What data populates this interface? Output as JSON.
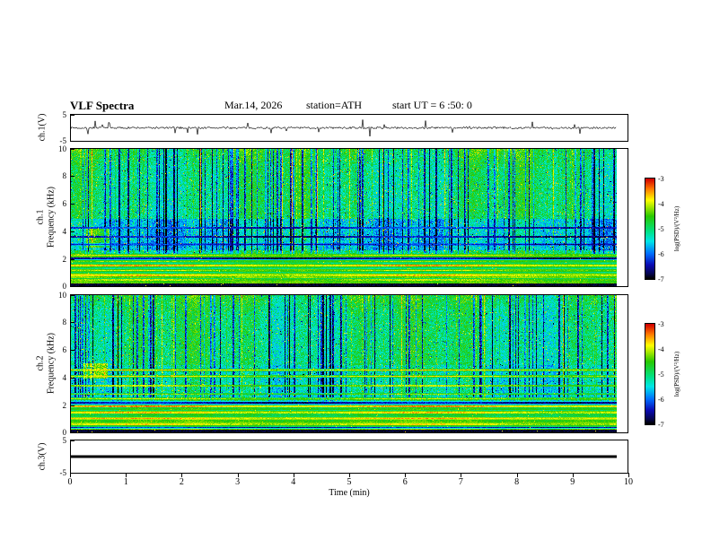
{
  "header": {
    "title": "VLF Spectra",
    "date": "Mar.14, 2026",
    "station": "station=ATH",
    "start_ut": "start UT =  6 :50: 0"
  },
  "x_axis": {
    "label": "Time (min)",
    "ticks": [
      0,
      1,
      2,
      3,
      4,
      5,
      6,
      7,
      8,
      9,
      10
    ],
    "range": [
      0,
      10
    ]
  },
  "colorbar": {
    "label": "log(PSD)/(V²/Hz)",
    "ticks": [
      -3,
      -4,
      -5,
      -6,
      -7
    ],
    "range": [
      -3,
      -7
    ],
    "gradient_top_to_bottom": [
      "#d20000",
      "#ff7800",
      "#ffff00",
      "#28c800",
      "#00e182",
      "#00e6e6",
      "#006eff",
      "#0a0ab4",
      "#050550",
      "#000000"
    ]
  },
  "chart_data": [
    {
      "type": "line",
      "panel": "ch1-waveform",
      "ylabel": "ch.1(V)",
      "ylim": [
        -5,
        5
      ],
      "y_ticks": [
        5,
        -5
      ],
      "x_range_min": [
        0,
        9.8
      ],
      "description": "Broadband noise trace oscillating around 0 V with frequent impulsive sferic spikes up to about ±4 V",
      "seed": 7,
      "noise_v": 0.4,
      "spike_prob": 0.05,
      "spike_v": 3.0
    },
    {
      "type": "heatmap",
      "panel": "ch1-spectrogram",
      "ylabel_ch": "ch.1",
      "ylabel_axis": "Frequency (kHz)",
      "ylim": [
        0,
        10
      ],
      "y_ticks": [
        0,
        2,
        4,
        6,
        8,
        10
      ],
      "x_range_min": [
        0,
        9.8
      ],
      "value_range": [
        -7,
        -3
      ],
      "description": "VLF power spectral density: green/cyan background near -5, dense vertical dark-blue dropout stripes above 2.3 kHz, suppressed blue band 2.6-4.9 kHz, strong red/orange horizontal lines below 2.3 kHz, black band at 0 kHz, bright patch near 0.3-0.7 min at 3-4 kHz",
      "seed": 21,
      "stripe_density": 0.17,
      "bands": [
        {
          "f0": 2.6,
          "f1": 4.9,
          "dv": -0.55
        },
        {
          "f0": 0.18,
          "f1": 2.3,
          "dv": 0.15
        },
        {
          "f0": 0.18,
          "f1": 1.0,
          "dv": 0.3
        }
      ],
      "lines": [
        {
          "f": 0.45,
          "w": 0.05,
          "level": -4.3
        },
        {
          "f": 0.8,
          "w": 0.05,
          "level": -3.9
        },
        {
          "f": 1.15,
          "w": 0.04,
          "level": -4.2
        },
        {
          "f": 1.5,
          "w": 0.05,
          "level": -3.8
        },
        {
          "f": 1.8,
          "w": 0.04,
          "level": -4.4
        },
        {
          "f": 2.0,
          "w": 0.06,
          "level": -6.6
        },
        {
          "f": 2.25,
          "w": 0.04,
          "level": -4.1
        },
        {
          "f": 3.05,
          "w": 0.05,
          "level": -6.4
        },
        {
          "f": 3.6,
          "w": 0.05,
          "level": -6.5
        },
        {
          "f": 4.25,
          "w": 0.05,
          "level": -6.3
        }
      ],
      "blobs": [
        {
          "t0": 0.25,
          "t1": 0.7,
          "f0": 2.8,
          "f1": 4.3,
          "dv": 1.2
        }
      ]
    },
    {
      "type": "heatmap",
      "panel": "ch2-spectrogram",
      "ylabel_ch": "ch.2",
      "ylabel_axis": "Frequency (kHz)",
      "ylim": [
        0,
        10
      ],
      "y_ticks": [
        0,
        2,
        4,
        6,
        8,
        10
      ],
      "x_range_min": [
        0,
        9.8
      ],
      "value_range": [
        -7,
        -3
      ],
      "description": "Similar to ch.1 but less suppression at mid band; red horizontal lines near 4.1 and 4.55 kHz, dense warm horizontal streaks below 2.3 kHz, dark line near 2.15 kHz, black band at 0 kHz, bright yellow patch near 0.3 min at 4-5 kHz",
      "seed": 55,
      "stripe_density": 0.13,
      "bands": [
        {
          "f0": 2.5,
          "f1": 4.9,
          "dv": -0.25
        },
        {
          "f0": 0.18,
          "f1": 2.3,
          "dv": 0.2
        },
        {
          "f0": 0.18,
          "f1": 1.0,
          "dv": 0.3
        }
      ],
      "lines": [
        {
          "f": 0.35,
          "w": 0.04,
          "level": -6.4
        },
        {
          "f": 0.6,
          "w": 0.05,
          "level": -4.0
        },
        {
          "f": 1.0,
          "w": 0.05,
          "level": -3.8
        },
        {
          "f": 1.45,
          "w": 0.05,
          "level": -3.9
        },
        {
          "f": 1.9,
          "w": 0.05,
          "level": -3.7
        },
        {
          "f": 2.15,
          "w": 0.07,
          "level": -6.5
        },
        {
          "f": 2.45,
          "w": 0.04,
          "level": -4.2
        },
        {
          "f": 2.8,
          "w": 0.04,
          "level": -4.4
        },
        {
          "f": 3.4,
          "w": 0.04,
          "level": -4.3
        },
        {
          "f": 4.1,
          "w": 0.05,
          "level": -4.0
        },
        {
          "f": 4.55,
          "w": 0.05,
          "level": -3.9
        }
      ],
      "blobs": [
        {
          "t0": 0.2,
          "t1": 0.65,
          "f0": 3.9,
          "f1": 5.0,
          "dv": 1.4
        }
      ]
    },
    {
      "type": "line",
      "panel": "ch3-waveform",
      "ylabel": "ch.3(V)",
      "ylim": [
        -5,
        5
      ],
      "y_ticks": [
        5,
        -5
      ],
      "x_range_min": [
        0,
        9.8
      ],
      "flat_value": 0,
      "description": "Flat thick black line at 0 V (no signal on channel 3)"
    }
  ]
}
